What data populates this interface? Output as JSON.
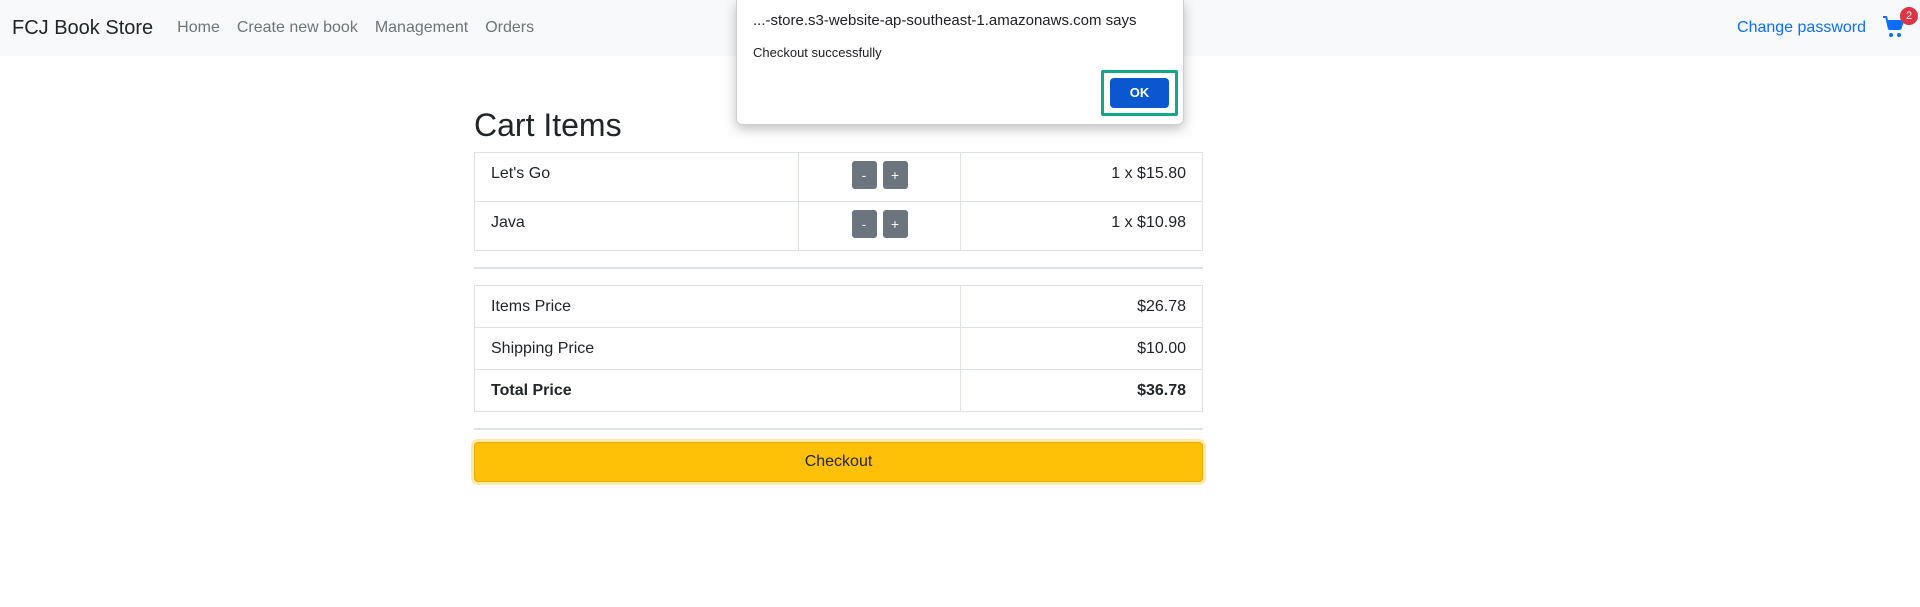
{
  "navbar": {
    "brand": "FCJ Book Store",
    "links": [
      "Home",
      "Create new book",
      "Management",
      "Orders"
    ],
    "change_password": "Change password",
    "cart_count": "2",
    "cart_icon": "cart-icon"
  },
  "main": {
    "title": "Cart Items",
    "items": [
      {
        "name": "Let's Go",
        "minus": "-",
        "plus": "+",
        "qty_price": "1 x $15.80"
      },
      {
        "name": "Java",
        "minus": "-",
        "plus": "+",
        "qty_price": "1 x $10.98"
      }
    ],
    "summary": {
      "items_label": "Items Price",
      "items_value": "$26.78",
      "shipping_label": "Shipping Price",
      "shipping_value": "$10.00",
      "total_label": "Total Price",
      "total_value": "$36.78"
    },
    "checkout_label": "Checkout"
  },
  "dialog": {
    "title": "...-store.s3-website-ap-southeast-1.amazonaws.com says",
    "message": "Checkout successfully",
    "ok_label": "OK"
  },
  "colors": {
    "navbar_bg": "#f8f9fa",
    "link_blue": "#0d6efd",
    "checkout_yellow": "#ffc107",
    "badge_red": "#dc3545",
    "ok_blue": "#0b57d0",
    "focus_ring": "#12a68a"
  }
}
